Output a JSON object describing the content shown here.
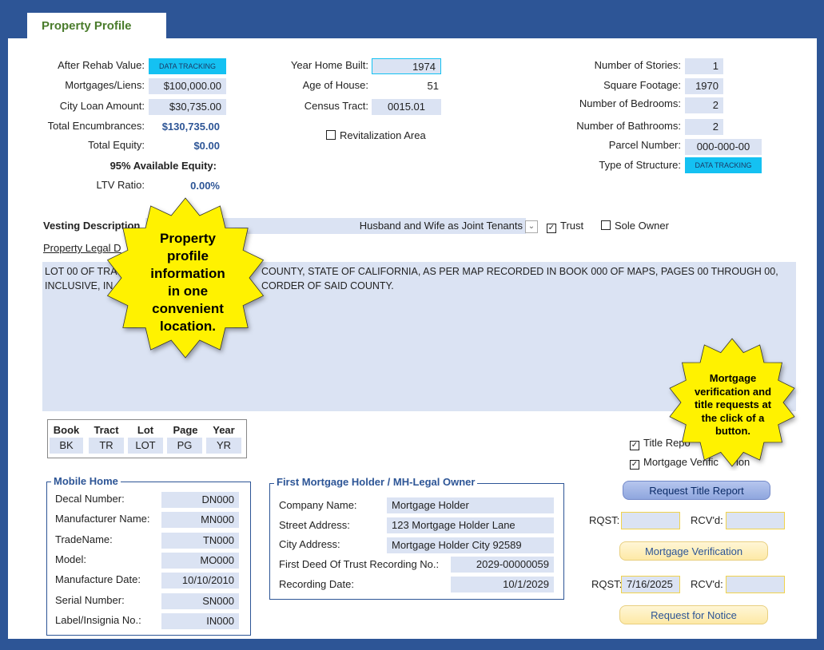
{
  "tab_title": "Property Profile",
  "left": {
    "after_rehab_label": "After Rehab Value:",
    "after_rehab_value": "DATA TRACKING",
    "mortgages_label": "Mortgages/Liens:",
    "mortgages_value": "$100,000.00",
    "city_loan_label": "City Loan Amount:",
    "city_loan_value": "$30,735.00",
    "total_enc_label": "Total Encumbrances:",
    "total_enc_value": "$130,735.00",
    "total_equity_label": "Total Equity:",
    "total_equity_value": "$0.00",
    "available_equity_label": "95% Available Equity:",
    "ltv_label": "LTV Ratio:",
    "ltv_value": "0.00%"
  },
  "middle": {
    "year_built_label": "Year Home Built:",
    "year_built_value": "1974",
    "age_label": "Age of House:",
    "age_value": "51",
    "census_label": "Census Tract:",
    "census_value": "0015.01",
    "revitalization_label": "Revitalization Area"
  },
  "right": {
    "stories_label": "Number of Stories:",
    "stories_value": "1",
    "sqft_label": "Square Footage:",
    "sqft_value": "1970",
    "bedrooms_label": "Number of Bedrooms:",
    "bedrooms_value": "2",
    "bathrooms_label": "Number of Bathrooms:",
    "bathrooms_value": "2",
    "parcel_label": "Parcel Number:",
    "parcel_value": "000-000-00",
    "structure_label": "Type of Structure:",
    "structure_value": "DATA TRACKING"
  },
  "vesting": {
    "label": "Vesting Description",
    "value": "Husband and Wife as Joint Tenants",
    "trust_label": "Trust",
    "trust_checked": "☑",
    "sole_owner_label": "Sole Owner"
  },
  "legal": {
    "label_visible": "Property Legal D",
    "line1_left": "LOT 00 OF TRA",
    "line1_right": "COUNTY, STATE OF CALIFORNIA, AS PER MAP RECORDED IN BOOK 000 OF MAPS, PAGES 00 THROUGH 00,",
    "line2_left": "INCLUSIVE, IN",
    "line2_right": "CORDER OF SAID COUNTY."
  },
  "book_table": {
    "headers": [
      "Book",
      "Tract",
      "Lot",
      "Page",
      "Year"
    ],
    "values": [
      "BK",
      "TR",
      "LOT",
      "PG",
      "YR"
    ]
  },
  "checkboxes": {
    "title_report_label": "Title Repo",
    "mortgage_verif_label": "Mortgage Verific",
    "mortgage_verif_tail": "ion"
  },
  "mobile_home": {
    "legend": "Mobile Home",
    "rows": [
      {
        "label": "Decal Number:",
        "value": "DN000"
      },
      {
        "label": "Manufacturer Name:",
        "value": "MN000"
      },
      {
        "label": "TradeName:",
        "value": "TN000"
      },
      {
        "label": "Model:",
        "value": "MO000"
      },
      {
        "label": "Manufacture Date:",
        "value": "10/10/2010"
      },
      {
        "label": "Serial Number:",
        "value": "SN000"
      },
      {
        "label": "Label/Insignia No.:",
        "value": "IN000"
      }
    ]
  },
  "first_mortgage": {
    "legend": "First Mortgage Holder / MH-Legal Owner",
    "company_label": "Company Name:",
    "company_value": "Mortgage Holder",
    "street_label": "Street Address:",
    "street_value": "123 Mortgage Holder Lane",
    "city_label": "City Address:",
    "city_value": "Mortgage Holder City 92589",
    "deed_label": "First Deed Of Trust Recording No.:",
    "deed_value": "2029-00000059",
    "recording_label": "Recording Date:",
    "recording_value": "10/1/2029"
  },
  "requests": {
    "title_report_button": "Request Title Report",
    "rqst_label": "RQST:",
    "rcvd_label": "RCV'd:",
    "rqst1_value": "",
    "rcvd1_value": "",
    "mortgage_verif_button": "Mortgage Verification",
    "rqst2_value": "7/16/2025",
    "rcvd2_value": "",
    "notice_button": "Request for Notice"
  },
  "callouts": {
    "left_lines": [
      "Property",
      "profile",
      "information",
      "in one",
      "convenient",
      "location."
    ],
    "right_lines": [
      "Mortgage",
      "verification and",
      "title requests at",
      "the click of a",
      "button."
    ]
  },
  "colors": {
    "frame": "#2d5596",
    "field_bg": "#dbe3f3",
    "tab_text": "#4a7c2c",
    "data_tracking": "#14c1f2",
    "callout": "#fff200"
  }
}
